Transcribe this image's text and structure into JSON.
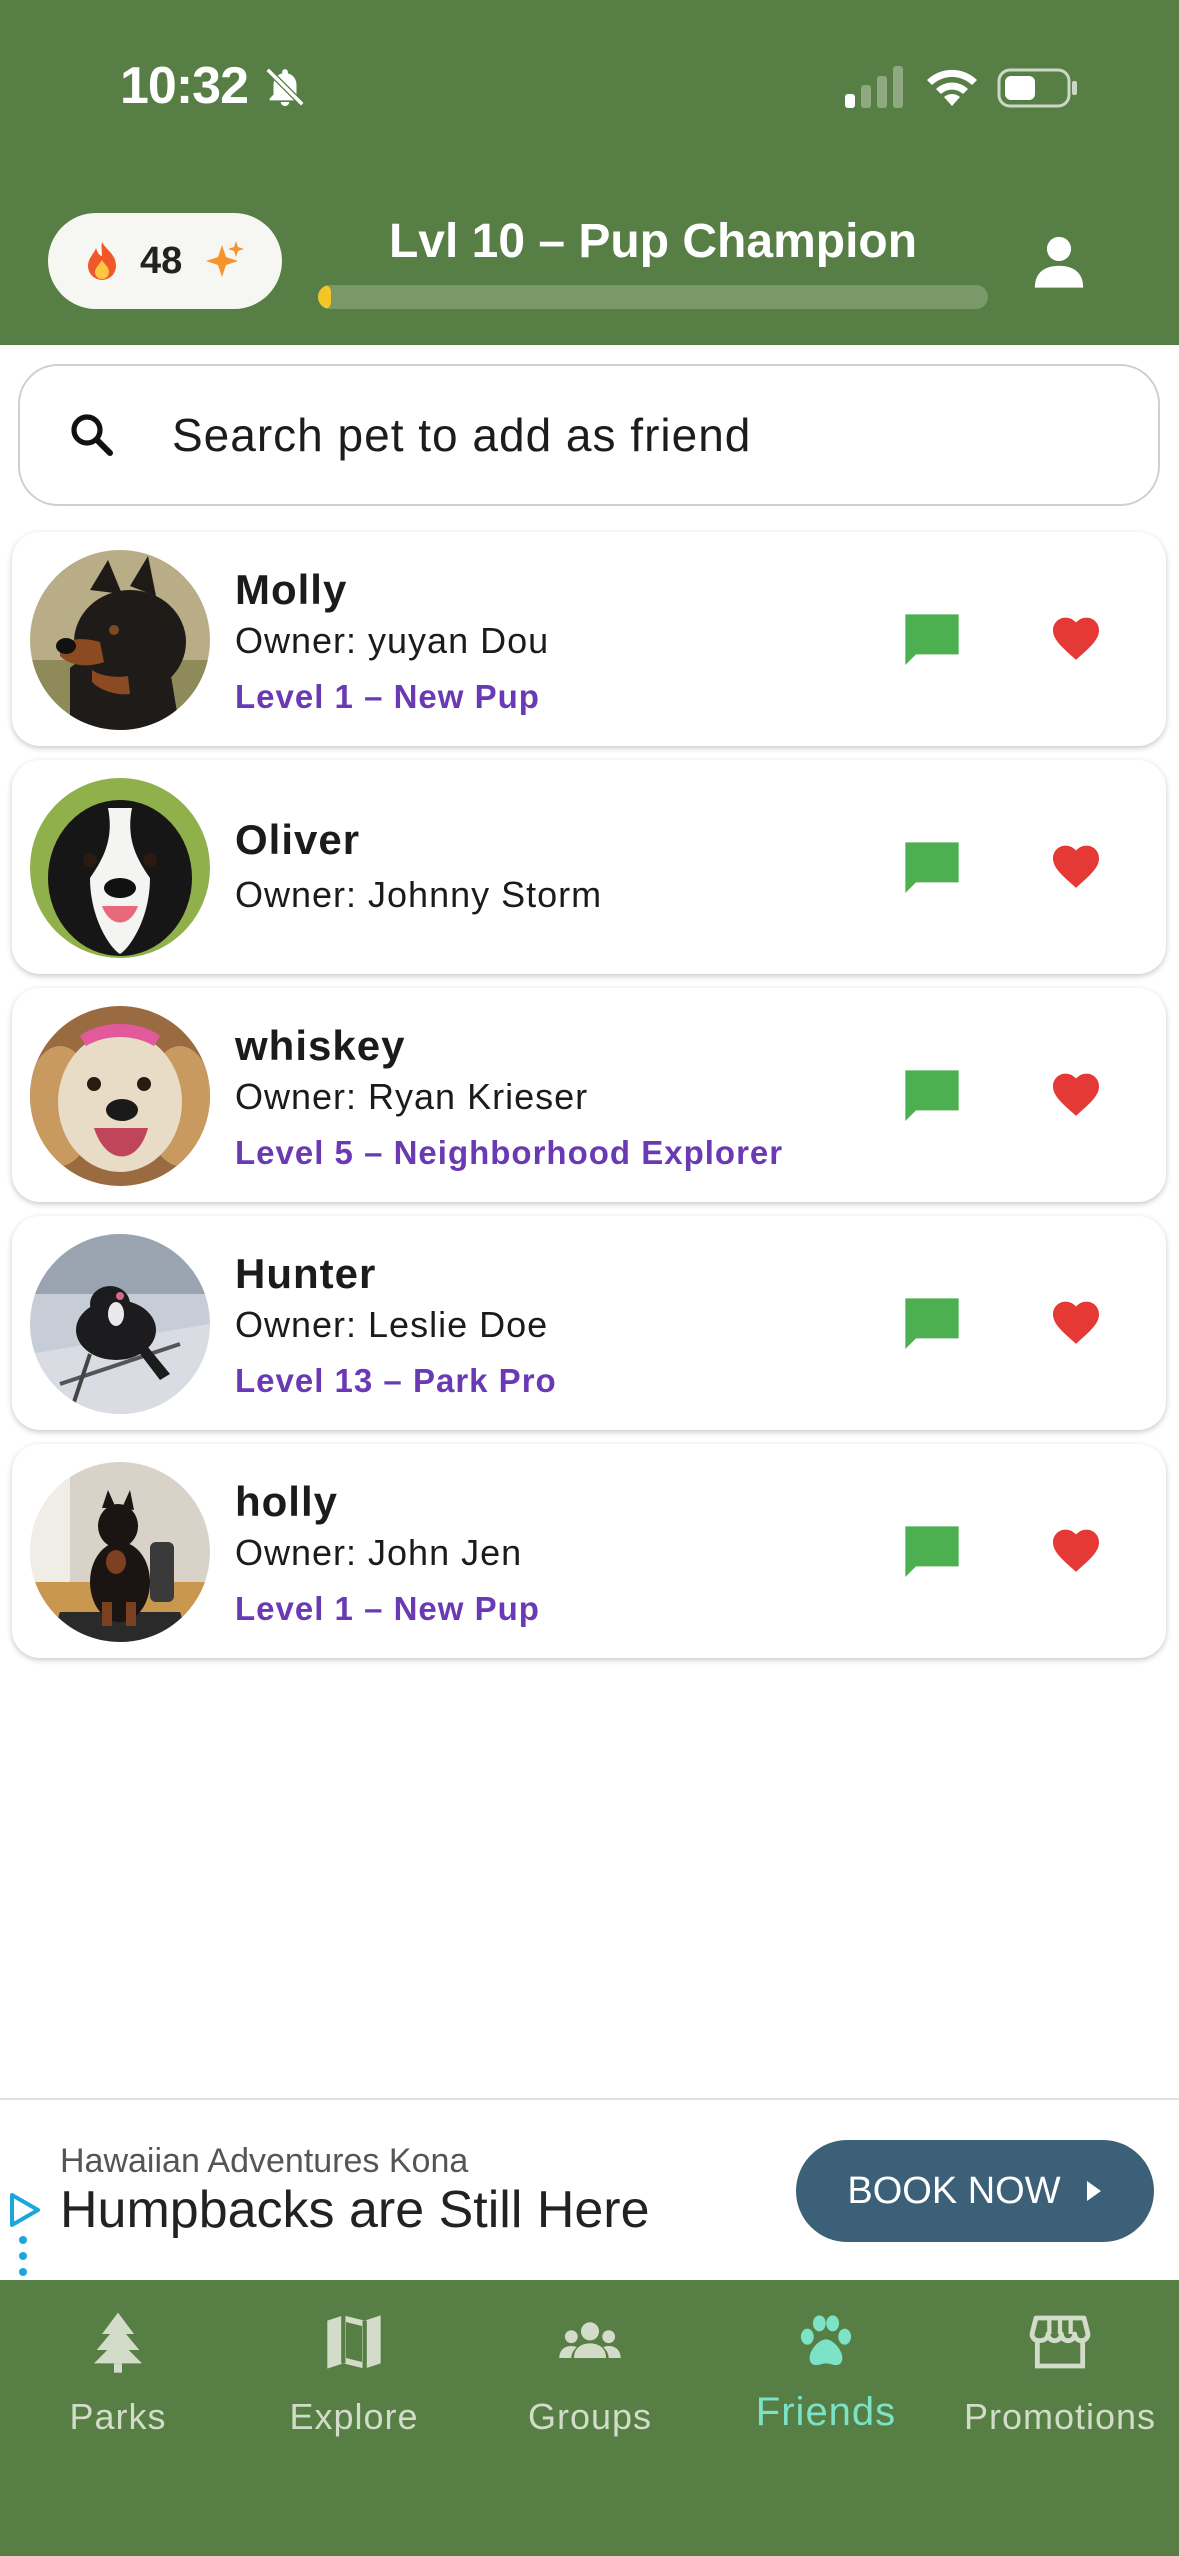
{
  "status_bar": {
    "time": "10:32"
  },
  "header": {
    "streak_count": "48",
    "level_title": "Lvl 10 – Pup Champion",
    "xp_progress_percent": 2
  },
  "search": {
    "placeholder": "Search pet to add as friend"
  },
  "friends": [
    {
      "name": "Molly",
      "owner": "Owner: yuyan Dou",
      "level": "Level 1 – New Pup"
    },
    {
      "name": "Oliver",
      "owner": "Owner: Johnny Storm",
      "level": ""
    },
    {
      "name": "whiskey",
      "owner": "Owner: Ryan Krieser",
      "level": "Level 5 – Neighborhood Explorer"
    },
    {
      "name": "Hunter",
      "owner": "Owner: Leslie Doe",
      "level": "Level 13 – Park Pro"
    },
    {
      "name": "holly",
      "owner": "Owner: John Jen",
      "level": "Level 1 – New Pup"
    }
  ],
  "ad": {
    "advertiser": "Hawaiian Adventures Kona",
    "headline": "Humpbacks are Still Here",
    "cta": "BOOK NOW"
  },
  "nav": {
    "items": [
      {
        "label": "Parks",
        "icon": "tree-icon"
      },
      {
        "label": "Explore",
        "icon": "map-icon"
      },
      {
        "label": "Groups",
        "icon": "group-icon"
      },
      {
        "label": "Friends",
        "icon": "paw-icon"
      },
      {
        "label": "Promotions",
        "icon": "storefront-icon"
      }
    ],
    "active": "Friends"
  },
  "colors": {
    "header_green": "#567e45",
    "level_purple": "#6a3ab5",
    "chat_green": "#4caf50",
    "heart_red": "#e53935",
    "active_tab": "#7de3c6",
    "xp_yellow": "#f2c626",
    "ad_button": "#3d6079"
  }
}
